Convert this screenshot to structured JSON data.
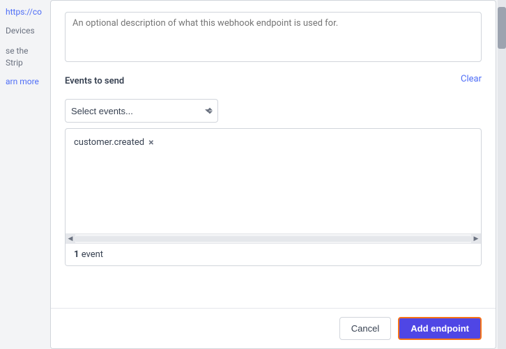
{
  "background": {
    "sidebar": {
      "url_text": "https://co",
      "devices_label": "Devices",
      "stripe_text": "se the Strip",
      "learn_more": "arn more"
    },
    "scrollbar_label": "vertical-scrollbar"
  },
  "modal": {
    "description_placeholder": "An optional description of what this webhook endpoint is used for.",
    "events_section_label": "Events to send",
    "select_placeholder": "Select events...",
    "clear_label": "Clear",
    "events": [
      {
        "name": "customer.created"
      }
    ],
    "events_count": "1",
    "events_count_suffix": " event",
    "footer": {
      "cancel_label": "Cancel",
      "add_endpoint_label": "Add endpoint"
    }
  }
}
